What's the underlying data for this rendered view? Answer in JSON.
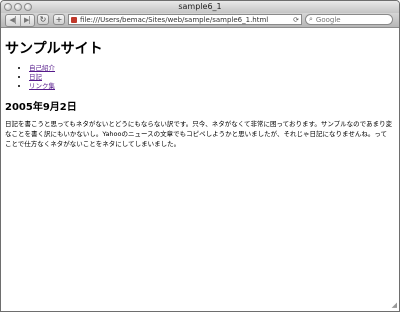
{
  "window": {
    "title": "sample6_1"
  },
  "toolbar": {
    "back_icon": "back-arrow",
    "forward_icon": "forward-arrow",
    "reload_icon": "reload",
    "add_icon": "plus",
    "url": "file:///Users/bemac/Sites/web/sample/sample6_1.html",
    "search_placeholder": "Google"
  },
  "page": {
    "heading": "サンプルサイト",
    "nav": [
      {
        "label": "自己紹介"
      },
      {
        "label": "日記"
      },
      {
        "label": "リンク集"
      }
    ],
    "date_heading": "2005年9月2日",
    "body": "日記を書こうと思ってもネタがないとどうにもならない訳です。只今、ネタがなくて非常に困っております。サンプルなのであまり変なことを書く訳にもいかないし。Yahooのニュースの文章でもコピペしようかと思いましたが、それじゃ日記になりませんね。ってことで仕方なくネタがないことをネタにしてしまいました。"
  }
}
